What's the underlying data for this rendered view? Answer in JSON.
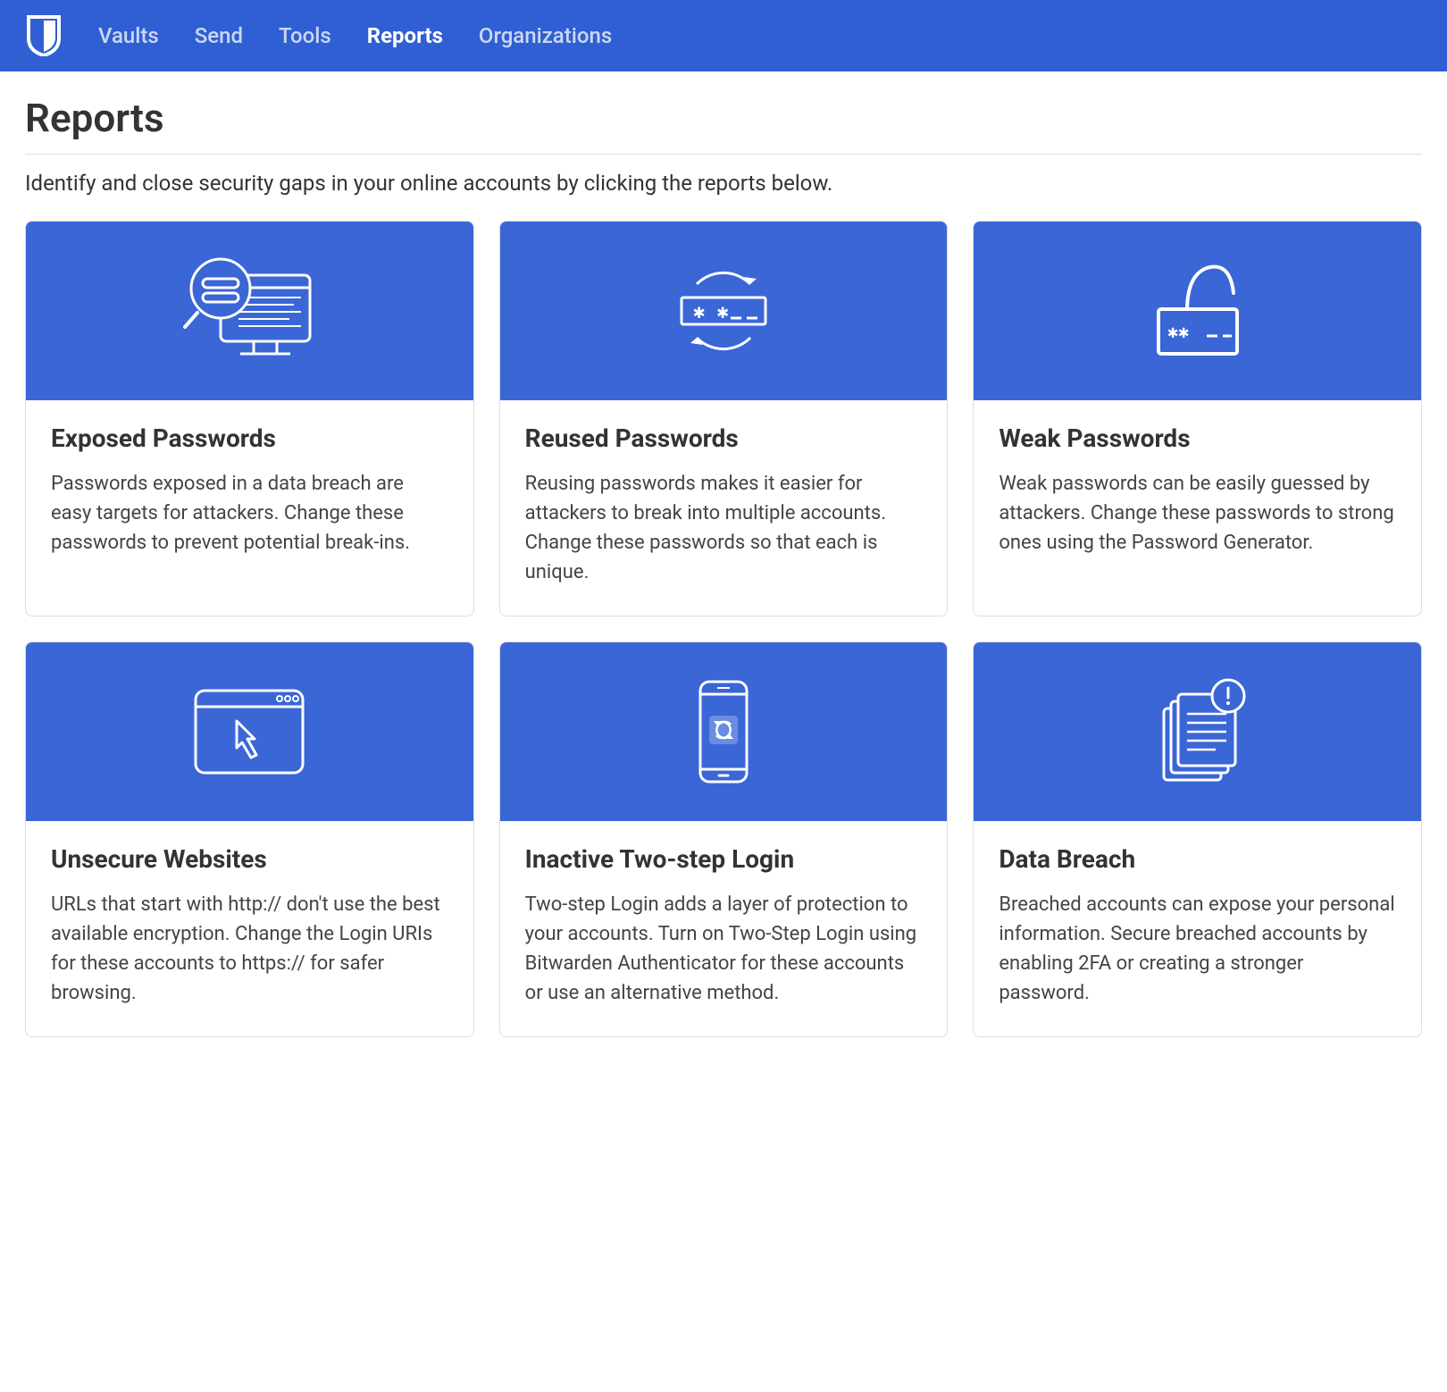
{
  "nav": {
    "items": [
      "Vaults",
      "Send",
      "Tools",
      "Reports",
      "Organizations"
    ],
    "active": "Reports"
  },
  "page": {
    "title": "Reports",
    "subtitle": "Identify and close security gaps in your online accounts by clicking the reports below."
  },
  "cards": [
    {
      "title": "Exposed Passwords",
      "description": "Passwords exposed in a data breach are easy targets for attackers. Change these passwords to prevent potential break-ins."
    },
    {
      "title": "Reused Passwords",
      "description": "Reusing passwords makes it easier for attackers to break into multiple accounts. Change these passwords so that each is unique."
    },
    {
      "title": "Weak Passwords",
      "description": "Weak passwords can be easily guessed by attackers. Change these passwords to strong ones using the Password Generator."
    },
    {
      "title": "Unsecure Websites",
      "description": "URLs that start with http:// don't use the best available encryption. Change the Login URIs for these accounts to https:// for safer browsing."
    },
    {
      "title": "Inactive Two-step Login",
      "description": "Two-step Login adds a layer of protection to your accounts. Turn on Two-Step Login using Bitwarden Authenticator for these accounts or use an alternative method."
    },
    {
      "title": "Data Breach",
      "description": "Breached accounts can expose your personal information. Secure breached accounts by enabling 2FA or creating a stronger password."
    }
  ]
}
